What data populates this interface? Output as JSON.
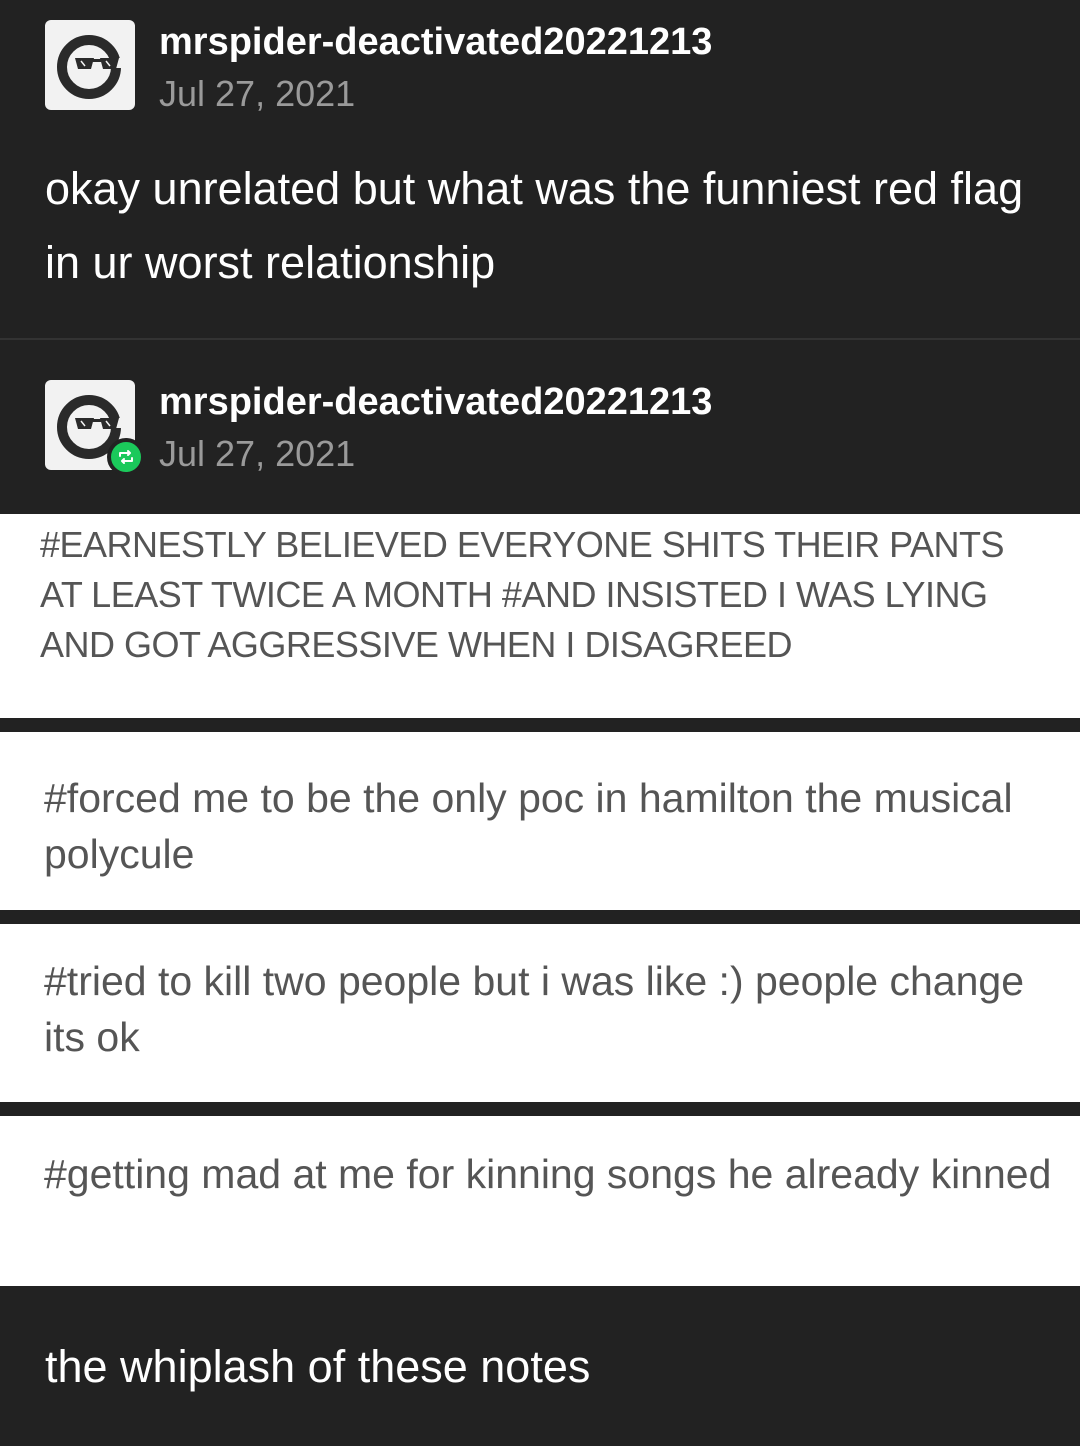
{
  "post": {
    "username": "mrspider-deactivated20221213",
    "date": "Jul 27, 2021",
    "text": "okay unrelated but what was the funniest red flag in ur worst relationship"
  },
  "reblog": {
    "username": "mrspider-deactivated20221213",
    "date": "Jul 27, 2021"
  },
  "tags": [
    "#EARNESTLY BELIEVED EVERYONE SHITS THEIR PANTS AT LEAST TWICE A MONTH  #AND INSISTED I WAS LYING AND GOT AGGRESSIVE WHEN I DISAGREED",
    "#forced me to be the only poc in hamilton the musical polycule",
    "#tried to kill two people but i was like :) people change its ok",
    "#getting mad at me for kinning songs he already kinned"
  ],
  "caption": "the whiplash of these notes",
  "colors": {
    "background": "#222222",
    "tag_panel": "#ffffff",
    "reblog_badge": "#1bc95b",
    "date": "#9a9a9a"
  },
  "icons": {
    "avatar": "sunglasses-avatar-icon",
    "reblog": "reblog-icon"
  }
}
